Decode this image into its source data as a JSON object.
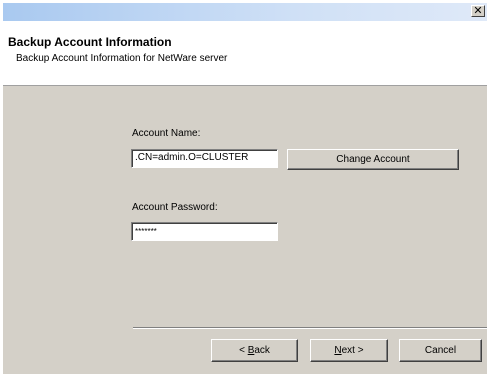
{
  "titlebar": {
    "close_icon": "close-icon",
    "close_glyph": "✕"
  },
  "header": {
    "title": "Backup Account Information",
    "subtitle": "Backup Account Information for NetWare server"
  },
  "form": {
    "account_name_label": "Account Name:",
    "account_name_value": ".CN=admin.O=CLUSTER",
    "change_account_label": "Change Account",
    "account_password_label": "Account Password:",
    "account_password_value": "*******"
  },
  "footer": {
    "back_prefix": "< ",
    "back_hotkey": "B",
    "back_rest": "ack",
    "next_hotkey": "N",
    "next_rest": "ext >",
    "cancel_label": "Cancel"
  },
  "colors": {
    "dialog_face": "#d4d0c8",
    "titlebar_blue": "#a9c9f0"
  }
}
